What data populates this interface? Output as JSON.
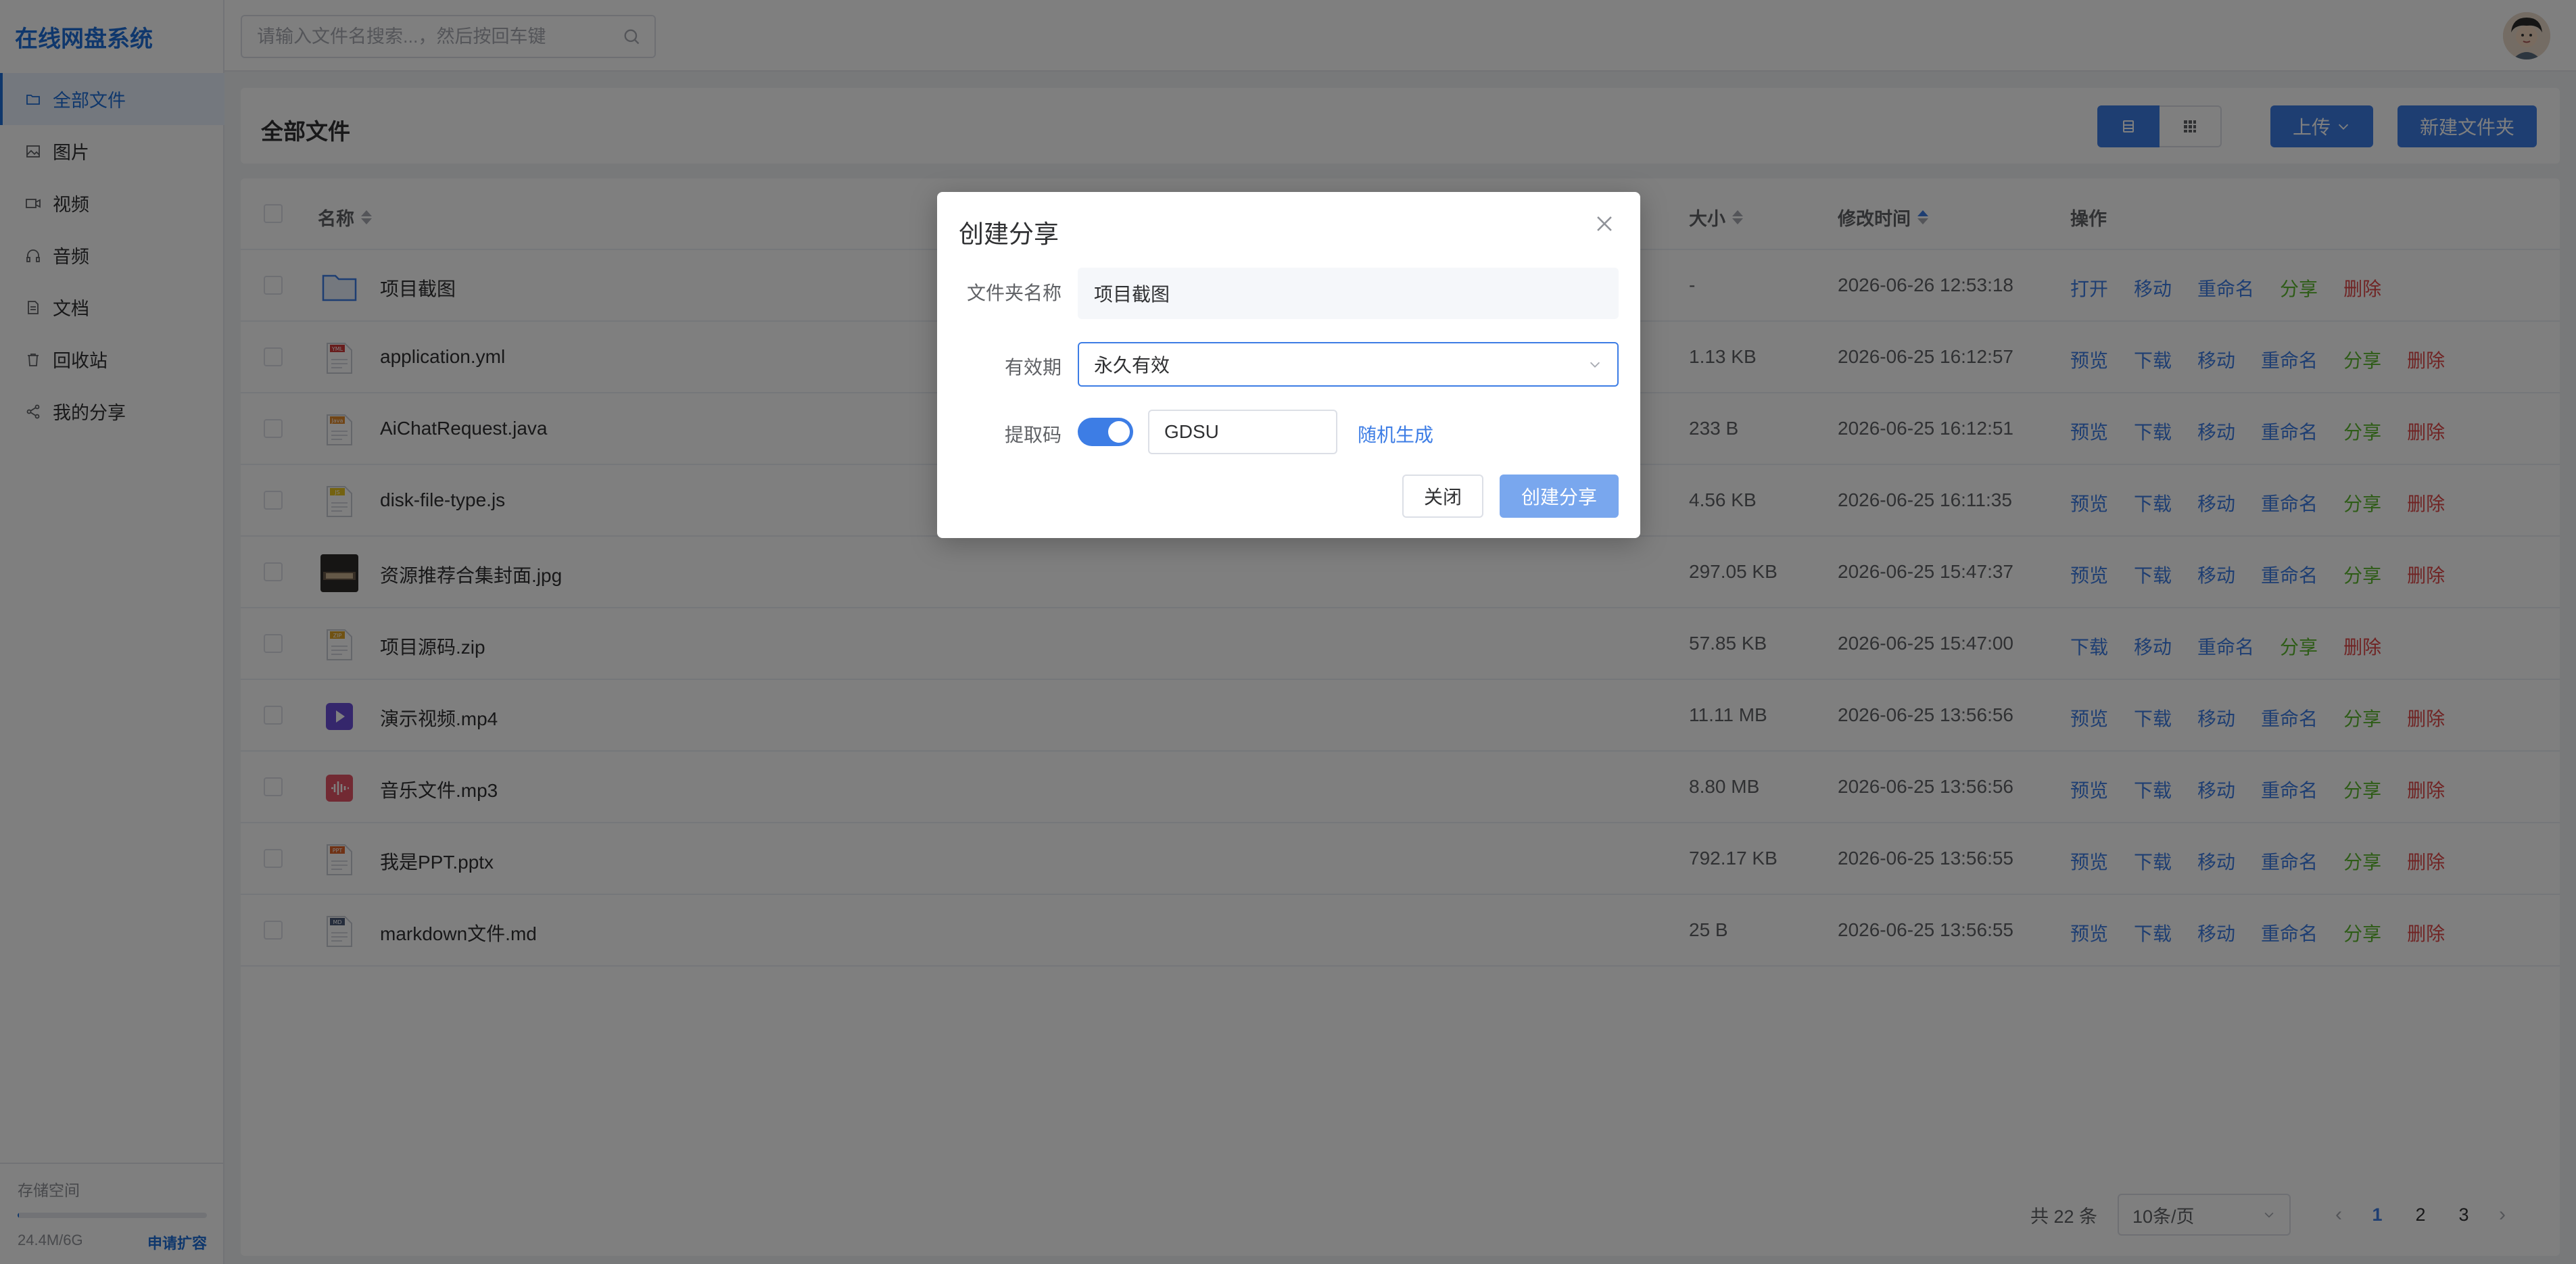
{
  "app": {
    "title": "在线网盘系统"
  },
  "sidebar": {
    "items": [
      {
        "label": "全部文件",
        "icon": "folder-icon"
      },
      {
        "label": "图片",
        "icon": "image-icon"
      },
      {
        "label": "视频",
        "icon": "video-icon"
      },
      {
        "label": "音频",
        "icon": "headphones-icon"
      },
      {
        "label": "文档",
        "icon": "document-icon"
      },
      {
        "label": "回收站",
        "icon": "trash-icon"
      },
      {
        "label": "我的分享",
        "icon": "share-icon"
      }
    ],
    "storage": {
      "title": "存储空间",
      "used": "24.4M/6G",
      "used_fraction": 0.004,
      "expand_label": "申请扩容"
    }
  },
  "topbar": {
    "search_placeholder": "请输入文件名搜索...，然后按回车键"
  },
  "main": {
    "title": "全部文件",
    "upload_label": "上传",
    "new_folder_label": "新建文件夹",
    "table": {
      "headers": {
        "name": "名称",
        "size": "大小",
        "time": "修改时间",
        "actions": "操作"
      },
      "rows": [
        {
          "name": "项目截图",
          "size": "-",
          "time": "2026-06-26 12:53:18",
          "type": "folder",
          "actions": [
            "打开",
            "移动",
            "重命名",
            "分享",
            "删除"
          ]
        },
        {
          "name": "application.yml",
          "size": "1.13 KB",
          "time": "2026-06-25 16:12:57",
          "type": "yml",
          "actions": [
            "预览",
            "下载",
            "移动",
            "重命名",
            "分享",
            "删除"
          ]
        },
        {
          "name": "AiChatRequest.java",
          "size": "233 B",
          "time": "2026-06-25 16:12:51",
          "type": "java",
          "actions": [
            "预览",
            "下载",
            "移动",
            "重命名",
            "分享",
            "删除"
          ]
        },
        {
          "name": "disk-file-type.js",
          "size": "4.56 KB",
          "time": "2026-06-25 16:11:35",
          "type": "js",
          "actions": [
            "预览",
            "下载",
            "移动",
            "重命名",
            "分享",
            "删除"
          ]
        },
        {
          "name": "资源推荐合集封面.jpg",
          "size": "297.05 KB",
          "time": "2026-06-25 15:47:37",
          "type": "jpg",
          "actions": [
            "预览",
            "下载",
            "移动",
            "重命名",
            "分享",
            "删除"
          ]
        },
        {
          "name": "项目源码.zip",
          "size": "57.85 KB",
          "time": "2026-06-25 15:47:00",
          "type": "zip",
          "actions": [
            "下载",
            "移动",
            "重命名",
            "分享",
            "删除"
          ]
        },
        {
          "name": "演示视频.mp4",
          "size": "11.11 MB",
          "time": "2026-06-25 13:56:56",
          "type": "mp4",
          "actions": [
            "预览",
            "下载",
            "移动",
            "重命名",
            "分享",
            "删除"
          ]
        },
        {
          "name": "音乐文件.mp3",
          "size": "8.80 MB",
          "time": "2026-06-25 13:56:56",
          "type": "mp3",
          "actions": [
            "预览",
            "下载",
            "移动",
            "重命名",
            "分享",
            "删除"
          ]
        },
        {
          "name": "我是PPT.pptx",
          "size": "792.17 KB",
          "time": "2026-06-25 13:56:55",
          "type": "ppt",
          "actions": [
            "预览",
            "下载",
            "移动",
            "重命名",
            "分享",
            "删除"
          ]
        },
        {
          "name": "markdown文件.md",
          "size": "25 B",
          "time": "2026-06-25 13:56:55",
          "type": "md",
          "actions": [
            "预览",
            "下载",
            "移动",
            "重命名",
            "分享",
            "删除"
          ]
        }
      ]
    },
    "pagination": {
      "total": "共 22 条",
      "page_size": "10条/页",
      "pages": [
        "1",
        "2",
        "3"
      ],
      "current": "1"
    }
  },
  "modal": {
    "title": "创建分享",
    "folder_label": "文件夹名称",
    "folder_value": "项目截图",
    "validity_label": "有效期",
    "validity_value": "永久有效",
    "code_label": "提取码",
    "code_value": "GDSU",
    "random_label": "随机生成",
    "close_label": "关闭",
    "create_label": "创建分享"
  },
  "colors": {
    "primary": "#3d7de5",
    "share": "#5cb82e",
    "delete": "#e04848",
    "brand": "#1e6fd9"
  }
}
